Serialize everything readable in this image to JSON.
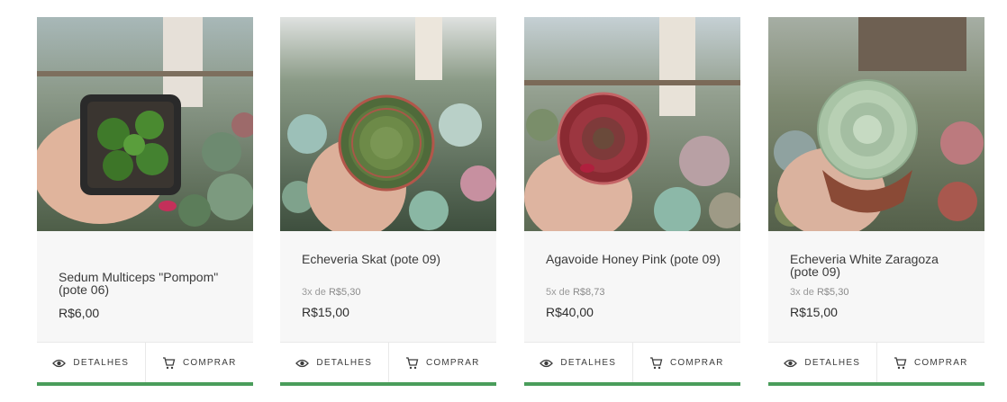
{
  "accent_color": "#4a9d5b",
  "products": [
    {
      "name": "Sedum Multiceps \"Pompom\" (pote 06)",
      "installments_prefix": "",
      "installments_value": "",
      "price": "R$6,00",
      "details_label": "DETALHES",
      "buy_label": "COMPRAR",
      "details_icon": "eye-icon",
      "buy_icon": "cart-icon"
    },
    {
      "name": "Echeveria Skat (pote 09)",
      "installments_prefix": "3x de ",
      "installments_value": "R$5,30",
      "price": "R$15,00",
      "details_label": "DETALHES",
      "buy_label": "COMPRAR",
      "details_icon": "eye-icon",
      "buy_icon": "cart-icon"
    },
    {
      "name": "Agavoide Honey Pink (pote 09)",
      "installments_prefix": "5x de ",
      "installments_value": "R$8,73",
      "price": "R$40,00",
      "details_label": "DETALHES",
      "buy_label": "COMPRAR",
      "details_icon": "eye-icon",
      "buy_icon": "cart-icon"
    },
    {
      "name": "Echeveria White Zaragoza (pote 09)",
      "installments_prefix": "3x de ",
      "installments_value": "R$5,30",
      "price": "R$15,00",
      "details_label": "DETALHES",
      "buy_label": "COMPRAR",
      "details_icon": "eye-icon",
      "buy_icon": "cart-icon"
    }
  ]
}
